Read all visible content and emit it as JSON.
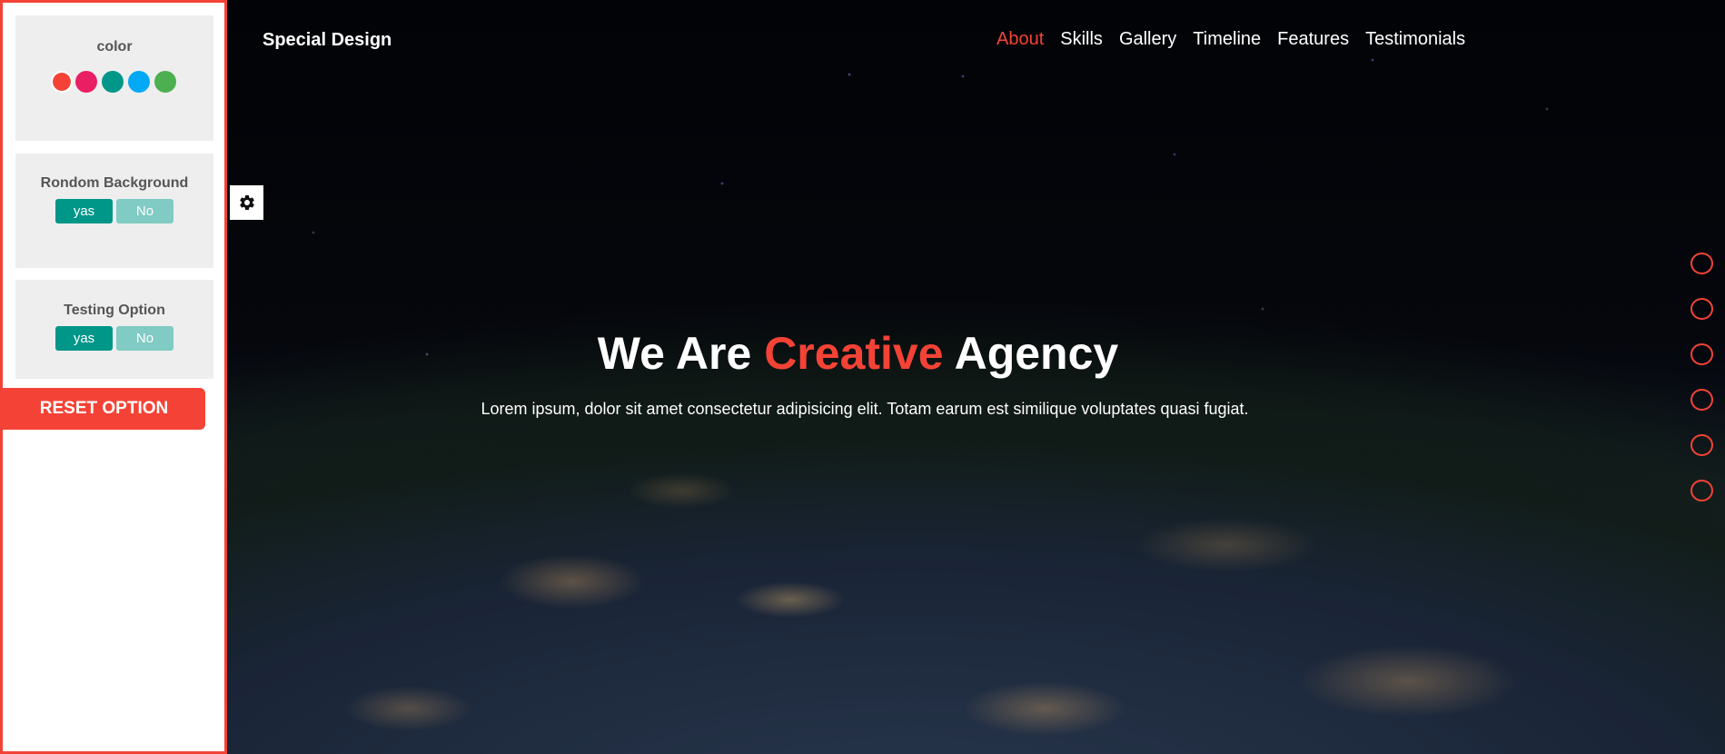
{
  "header": {
    "logo": "Special Design",
    "nav": [
      "About",
      "Skills",
      "Gallery",
      "Timeline",
      "Features",
      "Testimonials"
    ],
    "active_index": 0
  },
  "hero": {
    "title_before": "We Are ",
    "title_accent": "Creative",
    "title_after": " Agency",
    "subtitle": "Lorem ipsum, dolor sit amet consectetur adipisicing elit. Totam earum est similique voluptates quasi fugiat."
  },
  "settings": {
    "color_title": "color",
    "colors": [
      "#f44336",
      "#e91e63",
      "#009688",
      "#03a9f4",
      "#4caf50"
    ],
    "bg_title": "Rondom Background",
    "test_title": "Testing Option",
    "yes_label": "yas",
    "no_label": "No",
    "reset_label": "RESET OPTION",
    "gear_icon": "gear-icon"
  },
  "bullets_count": 6,
  "theme": {
    "accent": "#f44336",
    "teal": "#009688",
    "teal_light": "#80cbc4"
  }
}
